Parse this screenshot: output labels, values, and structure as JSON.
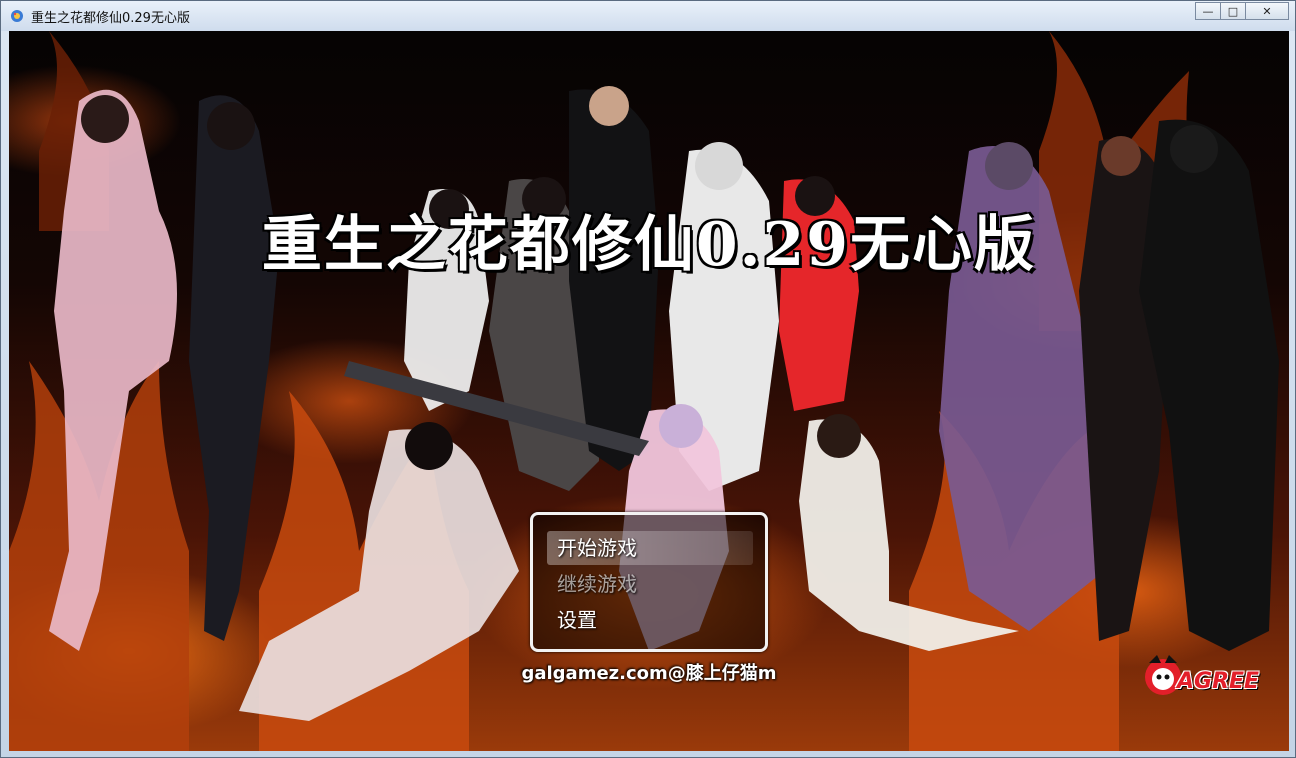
{
  "window": {
    "title": "重生之花都修仙0.29无心版",
    "minimize_glyph": "—",
    "maximize_glyph": "□",
    "close_glyph": "✕"
  },
  "game": {
    "title": "重生之花都修仙0.29无心版",
    "menu": [
      {
        "label": "开始游戏",
        "state": "selected"
      },
      {
        "label": "继续游戏",
        "state": "disabled"
      },
      {
        "label": "设置",
        "state": "normal"
      }
    ],
    "credit": "galgamez.com@膝上仔猫m",
    "logo_text": "AGREE"
  },
  "colors": {
    "title_bar": "#dbe6f2",
    "fire_orange": "#ff7a1a",
    "logo_red": "#e31f2a"
  },
  "icons": {
    "app_icon": "game-app-icon",
    "window_controls": [
      "minimize-icon",
      "maximize-icon",
      "close-icon"
    ]
  }
}
